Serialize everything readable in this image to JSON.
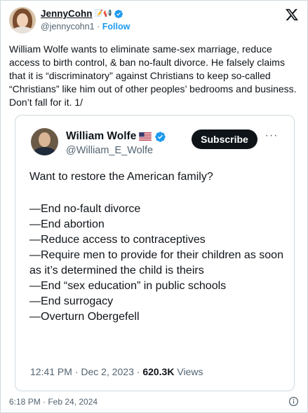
{
  "author": {
    "display_name": "JennyCohn",
    "name_emojis": "📝📢",
    "handle": "@jennycohn1",
    "separator": "·",
    "follow_label": "Follow"
  },
  "tweet": {
    "text": "William Wolfe wants to eliminate same-sex marriage, reduce access to birth control, & ban no-fault divorce. He falsely claims that it is “discriminatory” against Christians to keep so-called “Christians” like him out of other peoples’ bedrooms and business. Don’t fall for it. 1/",
    "timestamp": "6:18 PM · Feb 24, 2024"
  },
  "quoted": {
    "name": "William Wolfe",
    "handle": "@William_E_Wolfe",
    "subscribe_label": "Subscribe",
    "more_label": "···",
    "intro": "Want to restore the American family?",
    "items": [
      "—End no-fault divorce",
      "—End abortion",
      "—Reduce access to contraceptives",
      "—Require men to provide for their children as soon as it’s determined the child is theirs",
      "—End “sex education” in public schools",
      "—End surrogacy",
      "—Overturn Obergefell"
    ],
    "meta_time": "12:41 PM · Dec 2, 2023 · ",
    "meta_views": "620.3K",
    "meta_views_label": " Views"
  },
  "colors": {
    "accent": "#1d9bf0",
    "text": "#0f1419",
    "muted": "#536471",
    "border": "#cfd9de"
  },
  "icons": [
    "verified-badge-icon",
    "x-logo-icon",
    "us-flag-icon",
    "more-options-icon",
    "info-icon"
  ]
}
